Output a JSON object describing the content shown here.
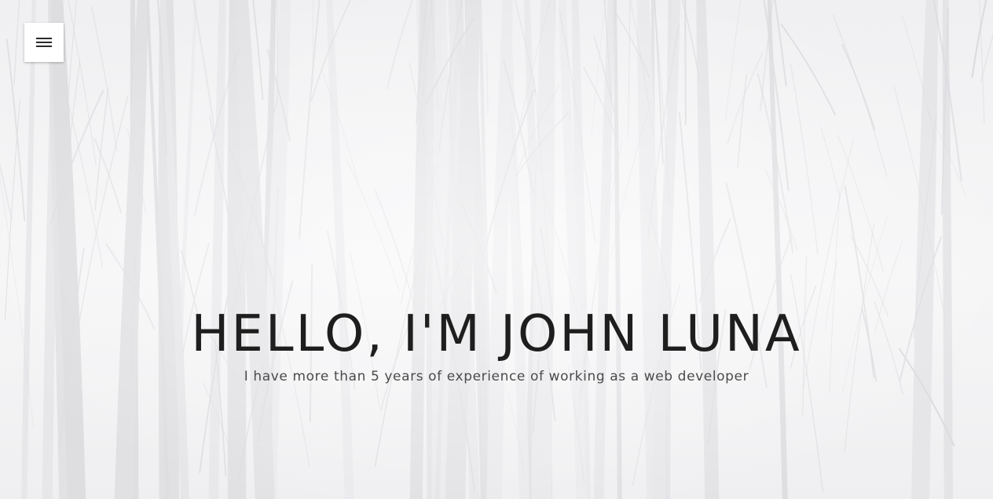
{
  "menu": {
    "icon": "hamburger-menu-icon"
  },
  "hero": {
    "title": "HELLO, I'M JOHN LUNA",
    "subtitle": "I have more than 5 years of experience of working as a web developer",
    "background": "misty-forest-trees-image"
  },
  "colors": {
    "background": "#f2f2f3",
    "title": "#1e1e1e",
    "subtitle": "#4a4a4a",
    "menu_button": "#ffffff"
  }
}
